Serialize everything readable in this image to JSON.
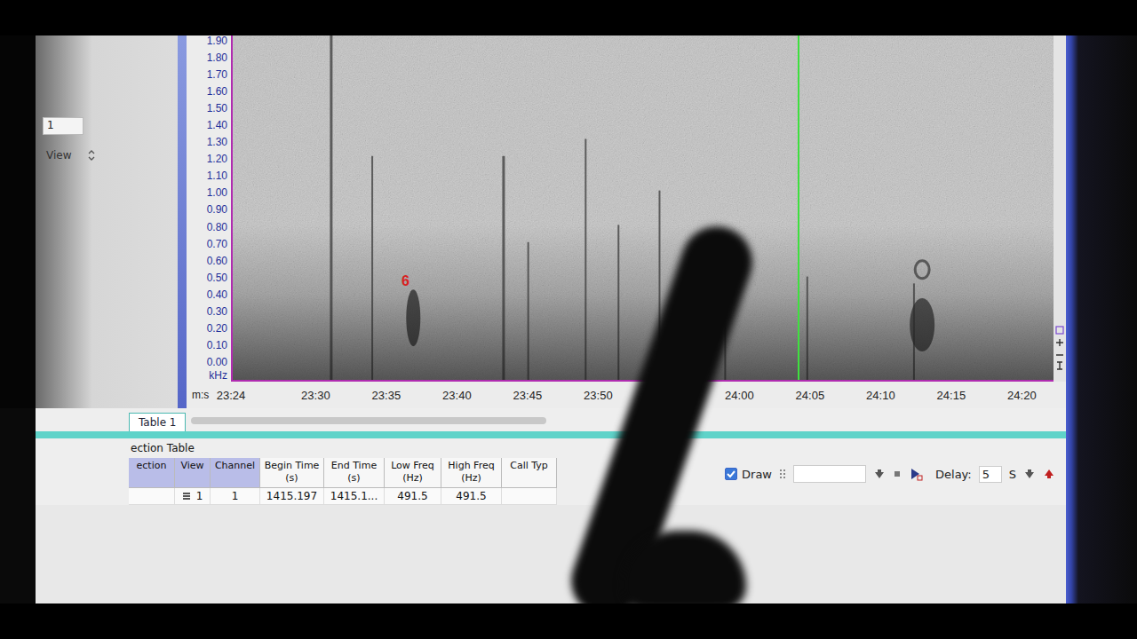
{
  "left_panel": {
    "field": "1",
    "view_label": "View"
  },
  "spectrogram": {
    "y_unit": "kHz",
    "y_ticks": [
      "1.90",
      "1.80",
      "1.70",
      "1.60",
      "1.50",
      "1.40",
      "1.30",
      "1.20",
      "1.10",
      "1.00",
      "0.90",
      "0.80",
      "0.70",
      "0.60",
      "0.50",
      "0.40",
      "0.30",
      "0.20",
      "0.10",
      "0.00"
    ],
    "x_prefix": "m:s",
    "x_ticks": [
      "23:24",
      "23:30",
      "23:35",
      "23:40",
      "23:45",
      "23:50",
      "24:00",
      "24:05",
      "24:10",
      "24:15",
      "24:20"
    ],
    "selection_label": {
      "text": "6",
      "color": "#d92020"
    }
  },
  "tabs": [
    {
      "label": "Table 1",
      "selected": true
    }
  ],
  "table": {
    "title": "ection Table",
    "columns": [
      "ection",
      "View",
      "Channel",
      "Begin Time (s)",
      "End Time (s)",
      "Low Freq (Hz)",
      "High Freq (Hz)",
      "Call Typ"
    ],
    "rows": [
      {
        "selected": false,
        "cells": [
          "1",
          "1",
          "1415.197",
          "1415.1...",
          "491.5",
          "491.5"
        ]
      }
    ]
  },
  "draw": {
    "label": "Draw",
    "checked": true
  },
  "delay": {
    "label": "Delay:",
    "value": "5",
    "unit": "S"
  }
}
